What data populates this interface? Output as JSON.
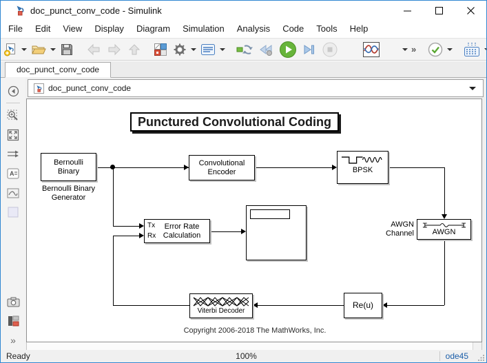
{
  "window": {
    "title": "doc_punct_conv_code - Simulink",
    "controls": {
      "minimize": "minimize",
      "maximize": "maximize",
      "close": "close"
    }
  },
  "menubar": {
    "items": [
      "File",
      "Edit",
      "View",
      "Display",
      "Diagram",
      "Simulation",
      "Analysis",
      "Code",
      "Tools",
      "Help"
    ]
  },
  "toolbar": {
    "icons": [
      "new-model",
      "open",
      "save",
      "navigate-back",
      "navigate-forward",
      "navigate-up",
      "library-browser",
      "model-settings",
      "model-configuration",
      "update-diagram",
      "step-back",
      "run",
      "step-forward",
      "stop",
      "simulation-data-inspector",
      "model-advisor",
      "build"
    ],
    "overflow": "»"
  },
  "tabbar": {
    "active_tab": "doc_punct_conv_code"
  },
  "breadcrumb": {
    "path": "doc_punct_conv_code"
  },
  "palette": {
    "icons": [
      "hide-explorer-bar",
      "zoom",
      "fit-to-view",
      "signal-routing",
      "annotation",
      "image",
      "sample-time-box",
      "screenshot",
      "viewmarks",
      "more-tools"
    ],
    "more_glyph": "»"
  },
  "canvas": {
    "title": "Punctured Convolutional Coding",
    "blocks": {
      "bernoulli": {
        "text": "Bernoulli\nBinary",
        "label": "Bernoulli Binary\nGenerator"
      },
      "conv_encoder": {
        "text": "Convolutional\nEncoder"
      },
      "bpsk": {
        "text": "BPSK"
      },
      "awgn": {
        "text": "AWGN",
        "label": "AWGN\nChannel"
      },
      "error_rate": {
        "text": "Error Rate\nCalculation",
        "port_tx": "Tx",
        "port_rx": "Rx"
      },
      "display": {},
      "viterbi": {
        "label": "Viterbi Decoder"
      },
      "reu": {
        "text": "Re(u)"
      }
    },
    "copyright": "Copyright 2006-2018 The MathWorks, Inc."
  },
  "statusbar": {
    "status": "Ready",
    "zoom": "100%",
    "solver": "ode45"
  },
  "colors": {
    "window_border": "#2f86d1",
    "run_green": "#67b43a",
    "solver_text": "#1a5da8",
    "library_red": "#d8513a",
    "library_blue": "#5b9bd5"
  }
}
